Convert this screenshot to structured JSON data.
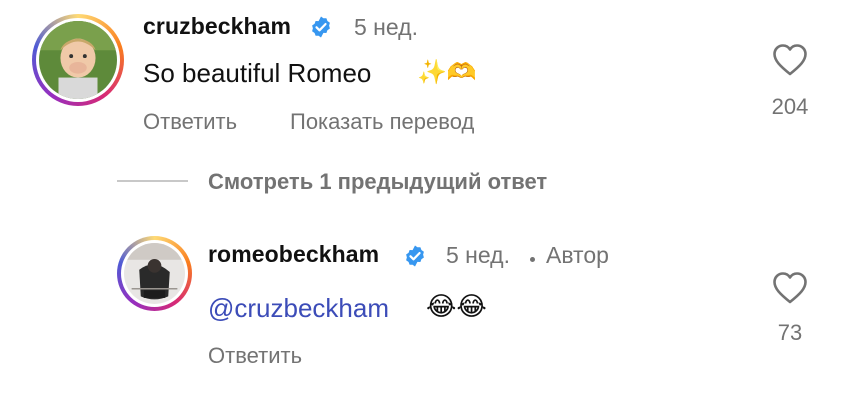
{
  "comment": {
    "username": "cruzbeckham",
    "time": "5 нед.",
    "text": "So beautiful Romeo",
    "emoji_trailing": "✨🫶",
    "reply_label": "Ответить",
    "translate_label": "Показать перевод",
    "likes": "204"
  },
  "view_replies_label": "Смотреть 1 предыдущий ответ",
  "reply": {
    "username": "romeobeckham",
    "time": "5 нед.",
    "author_label": "Автор",
    "mention": "@cruzbeckham",
    "emoji_trailing": "😂😂",
    "reply_label": "Ответить",
    "likes": "73"
  },
  "colors": {
    "verified_blue": "#3797f0",
    "mention_blue": "#3c4cb8",
    "secondary_text": "#737373"
  },
  "icons": {
    "verified": "verified-badge-icon",
    "like": "heart-outline-icon"
  }
}
